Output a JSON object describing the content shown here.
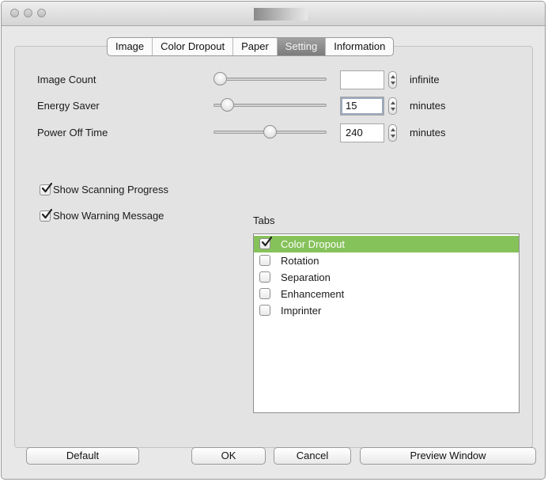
{
  "tabs": [
    {
      "label": "Image"
    },
    {
      "label": "Color Dropout"
    },
    {
      "label": "Paper"
    },
    {
      "label": "Setting"
    },
    {
      "label": "Information"
    }
  ],
  "settings": {
    "image_count": {
      "label": "Image Count",
      "value": "",
      "unit": "infinite",
      "slider_fraction": 0.0
    },
    "energy_saver": {
      "label": "Energy Saver",
      "value": "15",
      "unit": "minutes",
      "slider_fraction": 0.07
    },
    "power_off_time": {
      "label": "Power Off Time",
      "value": "240",
      "unit": "minutes",
      "slider_fraction": 0.5
    }
  },
  "options": {
    "show_scanning_progress": {
      "label": "Show Scanning Progress",
      "checked": true
    },
    "show_warning_message": {
      "label": "Show Warning Message",
      "checked": true
    }
  },
  "tabs_list": {
    "label": "Tabs",
    "items": [
      {
        "label": "Color Dropout",
        "checked": true,
        "selected": true
      },
      {
        "label": "Rotation",
        "checked": false,
        "selected": false
      },
      {
        "label": "Separation",
        "checked": false,
        "selected": false
      },
      {
        "label": "Enhancement",
        "checked": false,
        "selected": false
      },
      {
        "label": "Imprinter",
        "checked": false,
        "selected": false
      }
    ]
  },
  "buttons": {
    "default": "Default",
    "ok": "OK",
    "cancel": "Cancel",
    "preview": "Preview Window"
  },
  "colors": {
    "selection": "#86c25a",
    "active_tab": "#8c8c8c"
  }
}
